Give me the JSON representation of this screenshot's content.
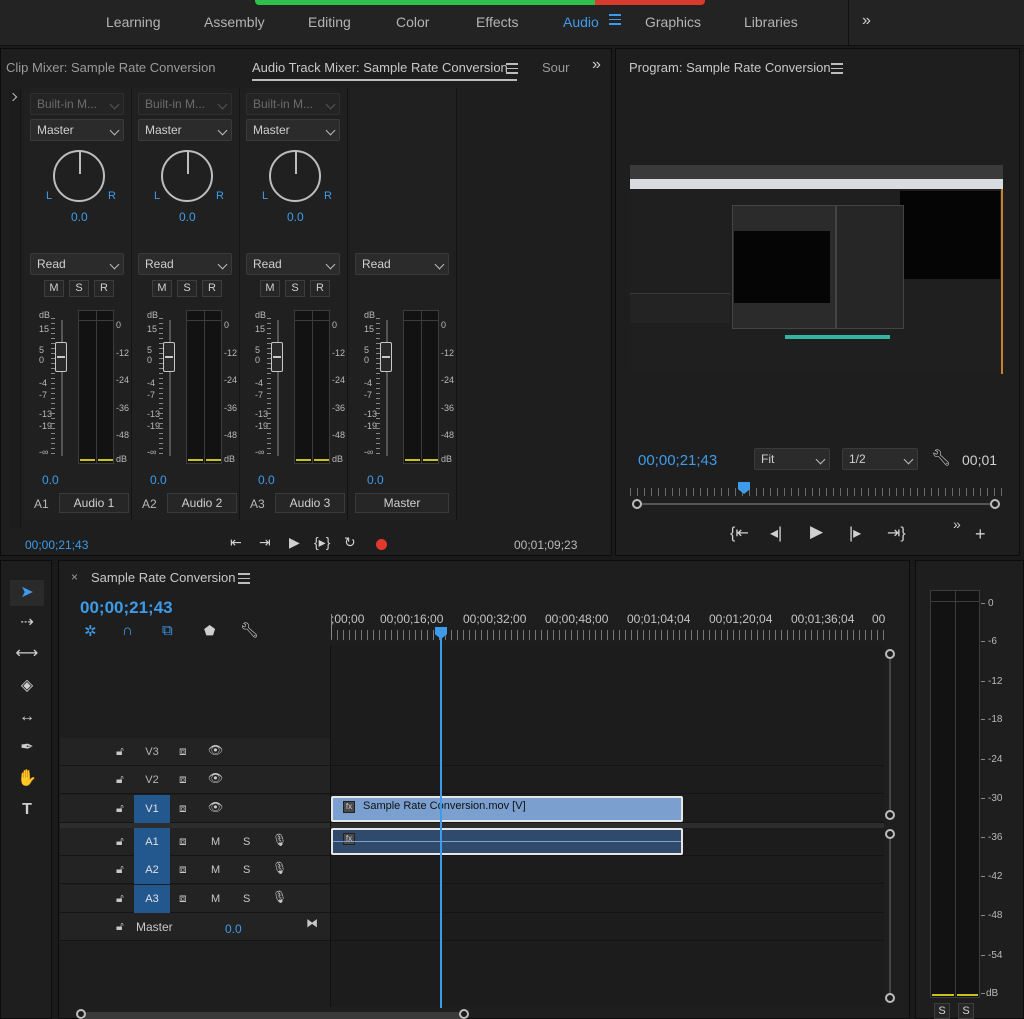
{
  "workspaces": {
    "tabs": [
      {
        "label": "Learning"
      },
      {
        "label": "Assembly"
      },
      {
        "label": "Editing"
      },
      {
        "label": "Color"
      },
      {
        "label": "Effects"
      },
      {
        "label": "Audio"
      },
      {
        "label": "Graphics"
      },
      {
        "label": "Libraries"
      }
    ],
    "active": "Audio",
    "more": "»"
  },
  "mixer": {
    "tabs": [
      {
        "label": "Clip Mixer: Sample Rate Conversion"
      },
      {
        "label": "Audio Track Mixer: Sample Rate Conversion"
      },
      {
        "label": "Sour"
      }
    ],
    "channels": [
      {
        "effect": "Built-in M...",
        "output": "Master",
        "pan_l": "L",
        "pan_r": "R",
        "pan_value": "0.0",
        "automation": "Read",
        "m": "M",
        "s": "S",
        "r": "R",
        "volume": "0.0",
        "id": "A1",
        "name": "Audio 1"
      },
      {
        "effect": "Built-in M...",
        "output": "Master",
        "pan_l": "L",
        "pan_r": "R",
        "pan_value": "0.0",
        "automation": "Read",
        "m": "M",
        "s": "S",
        "r": "R",
        "volume": "0.0",
        "id": "A2",
        "name": "Audio 2"
      },
      {
        "effect": "Built-in M...",
        "output": "Master",
        "pan_l": "L",
        "pan_r": "R",
        "pan_value": "0.0",
        "automation": "Read",
        "m": "M",
        "s": "S",
        "r": "R",
        "volume": "0.0",
        "id": "A3",
        "name": "Audio 3"
      },
      {
        "automation": "Read",
        "volume": "0.0",
        "name": "Master"
      }
    ],
    "fader_scale": [
      "dB",
      "15",
      "5",
      "0",
      "-4",
      "-7",
      "-13",
      "-19",
      "-∞"
    ],
    "meter_scale": [
      "0",
      "-12",
      "-24",
      "-36",
      "-48",
      "dB"
    ],
    "master_meter_scale": [
      "0",
      "-12",
      "-24",
      "-36",
      "-48",
      "dB"
    ],
    "timecode_current": "00;00;21;43",
    "timecode_duration": "00;01;09;23"
  },
  "program": {
    "title": "Program: Sample Rate Conversion",
    "timecode": "00;00;21;43",
    "fit": "Fit",
    "resolution": "1/2",
    "duration": "00;01"
  },
  "timeline": {
    "title": "Sample Rate Conversion",
    "close": "×",
    "timecode": "00;00;21;43",
    "ruler": [
      ";00;00",
      "00;00;16;00",
      "00;00;32;00",
      "00;00;48;00",
      "00;01;04;04",
      "00;01;20;04",
      "00;01;36;04",
      "00"
    ],
    "video_tracks": [
      {
        "id": "V3",
        "target": false
      },
      {
        "id": "V2",
        "target": false
      },
      {
        "id": "V1",
        "target": true
      }
    ],
    "audio_tracks": [
      {
        "id": "A1",
        "m": "M",
        "s": "S"
      },
      {
        "id": "A2",
        "m": "M",
        "s": "S"
      },
      {
        "id": "A3",
        "m": "M",
        "s": "S"
      }
    ],
    "master": {
      "label": "Master",
      "value": "0.0"
    },
    "clip_video": {
      "name": "Sample Rate Conversion.mov [V]",
      "fx": "fx"
    },
    "clip_audio": {
      "fx": "fx"
    }
  },
  "audio_meter": {
    "scale": [
      "0",
      "-6",
      "-12",
      "-18",
      "-24",
      "-30",
      "-36",
      "-42",
      "-48",
      "-54",
      "dB"
    ],
    "solo_l": "S",
    "solo_r": "S"
  },
  "colors": {
    "accent": "#3d9bea",
    "target": "#23588f",
    "clip_video": "#7b9fcf",
    "clip_audio": "#2f4a6b",
    "meter_peak": "#c8c21d"
  }
}
